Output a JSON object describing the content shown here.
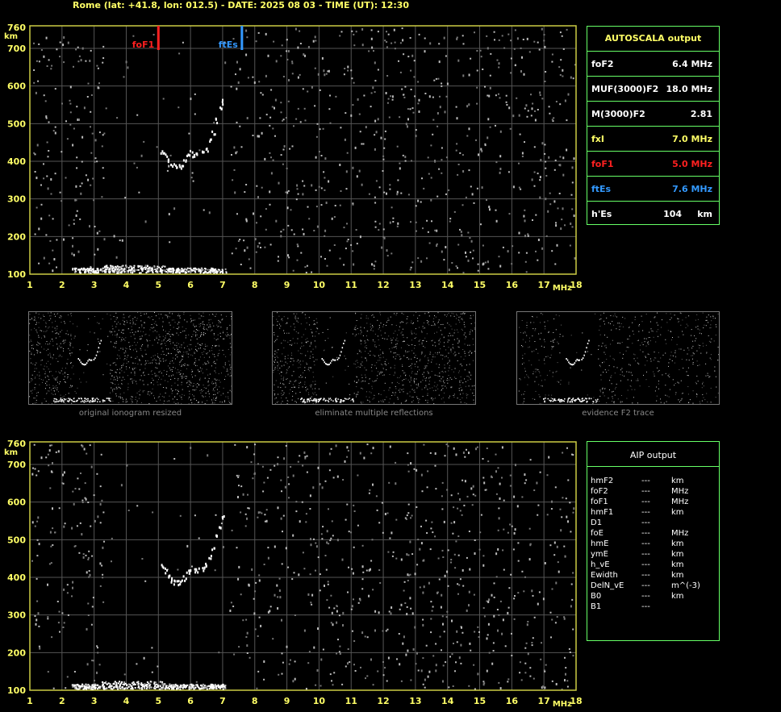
{
  "header": {
    "title": "Rome (lat: +41.8, lon: 012.5) - DATE: 2025 08 03 - TIME (UT): 12:30"
  },
  "autoscala": {
    "title": "AUTOSCALA output",
    "rows": [
      {
        "label": "foF2",
        "value": "6.4 MHz",
        "color": "#ffffff"
      },
      {
        "label": "MUF(3000)F2",
        "value": "18.0 MHz",
        "color": "#ffffff"
      },
      {
        "label": "M(3000)F2",
        "value": "2.81",
        "color": "#ffffff"
      },
      {
        "label": "fxI",
        "value": "7.0 MHz",
        "color": "#ffff66"
      },
      {
        "label": "foF1",
        "value": "5.0 MHz",
        "color": "#ff2020"
      },
      {
        "label": "ftEs",
        "value": "7.6 MHz",
        "color": "#3399ff"
      },
      {
        "label": "h'Es",
        "value": "104     km",
        "color": "#ffffff"
      }
    ]
  },
  "thumbnails": [
    {
      "caption": "original ionogram resized"
    },
    {
      "caption": "eliminate multiple reflections"
    },
    {
      "caption": "evidence F2 trace"
    }
  ],
  "aip": {
    "title": "AIP output",
    "rows": [
      {
        "param": "hmF2",
        "value": "---",
        "unit": "km"
      },
      {
        "param": "foF2",
        "value": "---",
        "unit": "MHz"
      },
      {
        "param": "foF1",
        "value": "---",
        "unit": "MHz"
      },
      {
        "param": "hmF1",
        "value": "---",
        "unit": "km"
      },
      {
        "param": "D1",
        "value": "---",
        "unit": ""
      },
      {
        "param": "foE",
        "value": "---",
        "unit": "MHz"
      },
      {
        "param": "hmE",
        "value": "---",
        "unit": "km"
      },
      {
        "param": "ymE",
        "value": "---",
        "unit": "km"
      },
      {
        "param": "h_vE",
        "value": "---",
        "unit": "km"
      },
      {
        "param": "Ewidth",
        "value": "---",
        "unit": "km"
      },
      {
        "param": "DelN_vE",
        "value": "---",
        "unit": "m^(-3)"
      },
      {
        "param": "B0",
        "value": "---",
        "unit": "km"
      },
      {
        "param": "B1",
        "value": "---",
        "unit": ""
      }
    ]
  },
  "chart_data": [
    {
      "type": "scatter",
      "panel": "main-ionogram",
      "xlabel": "MHz",
      "ylabel": "km",
      "xlim": [
        1,
        18
      ],
      "ylim": [
        100,
        760
      ],
      "x_ticks": [
        "1",
        "2",
        "3",
        "4",
        "5",
        "6",
        "7",
        "8",
        "9",
        "10",
        "11",
        "12",
        "13",
        "14",
        "15",
        "16",
        "17",
        "18"
      ],
      "y_ticks": [
        "100",
        "200",
        "300",
        "400",
        "500",
        "600",
        "700",
        "760"
      ],
      "grid": true,
      "markers": [
        {
          "name": "foF1",
          "x": 5.0,
          "color": "#ff2020"
        },
        {
          "name": "ftEs",
          "x": 7.6,
          "color": "#3399ff"
        }
      ],
      "traces": [
        {
          "name": "Es",
          "points": [
            [
              2.3,
              108
            ],
            [
              2.6,
              110
            ],
            [
              2.9,
              112
            ],
            [
              3.2,
              115
            ],
            [
              3.5,
              118
            ],
            [
              3.8,
              120
            ],
            [
              4.1,
              121
            ],
            [
              4.4,
              120
            ],
            [
              4.7,
              119
            ],
            [
              5.0,
              118
            ],
            [
              5.3,
              117
            ],
            [
              5.6,
              116
            ],
            [
              5.9,
              116
            ],
            [
              6.2,
              115
            ],
            [
              6.5,
              115
            ],
            [
              6.8,
              114
            ],
            [
              7.1,
              114
            ]
          ]
        },
        {
          "name": "F2",
          "points": [
            [
              5.1,
              430
            ],
            [
              5.2,
              420
            ],
            [
              5.3,
              405
            ],
            [
              5.4,
              395
            ],
            [
              5.5,
              390
            ],
            [
              5.6,
              388
            ],
            [
              5.7,
              390
            ],
            [
              5.8,
              400
            ],
            [
              5.9,
              415
            ],
            [
              6.0,
              425
            ],
            [
              6.1,
              420
            ],
            [
              6.2,
              420
            ],
            [
              6.4,
              425
            ],
            [
              6.5,
              435
            ],
            [
              6.6,
              455
            ],
            [
              6.7,
              480
            ],
            [
              6.8,
              510
            ],
            [
              6.9,
              540
            ],
            [
              7.0,
              560
            ]
          ]
        }
      ]
    },
    {
      "type": "scatter",
      "panel": "aip-ionogram",
      "xlabel": "MHz",
      "ylabel": "km",
      "xlim": [
        1,
        18
      ],
      "ylim": [
        100,
        760
      ],
      "x_ticks": [
        "1",
        "2",
        "3",
        "4",
        "5",
        "6",
        "7",
        "8",
        "9",
        "10",
        "11",
        "12",
        "13",
        "14",
        "15",
        "16",
        "17",
        "18"
      ],
      "y_ticks": [
        "100",
        "200",
        "300",
        "400",
        "500",
        "600",
        "700",
        "760"
      ],
      "grid": true
    }
  ]
}
